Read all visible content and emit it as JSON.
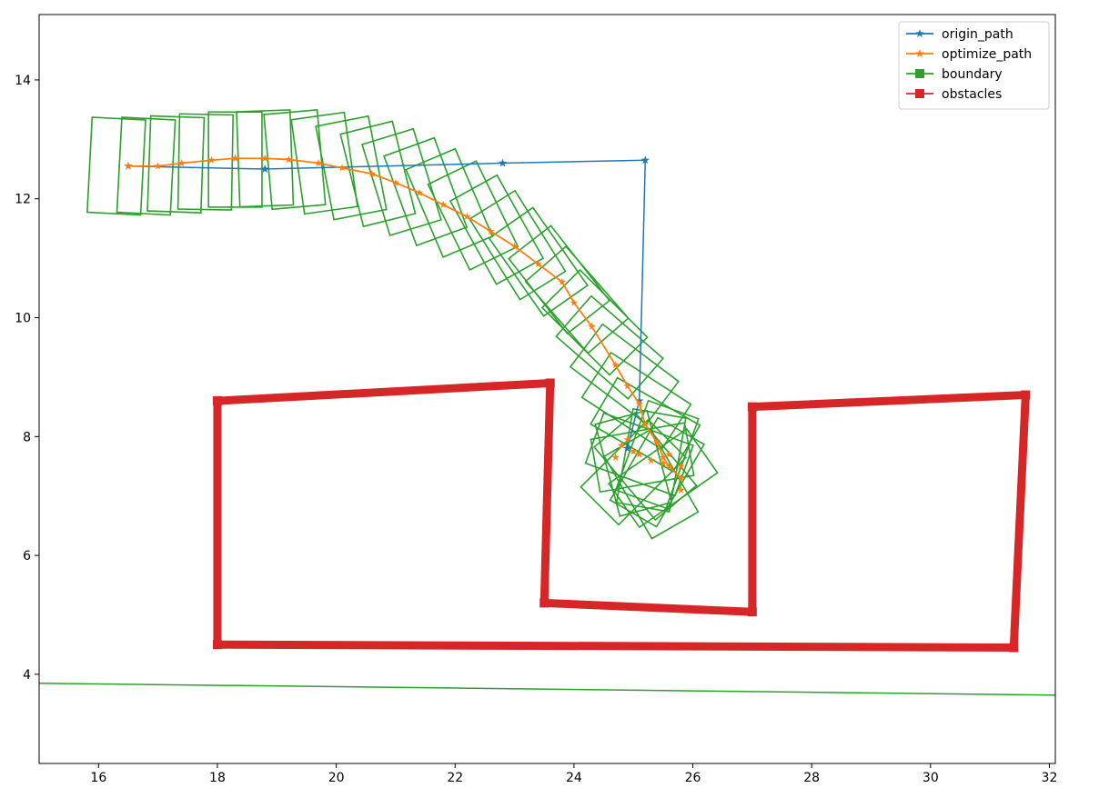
{
  "chart_data": {
    "type": "line",
    "xlim": [
      15,
      32.1
    ],
    "ylim": [
      2.5,
      15.1
    ],
    "x_ticks": [
      16,
      18,
      20,
      22,
      24,
      26,
      28,
      30,
      32
    ],
    "y_ticks": [
      4,
      6,
      8,
      10,
      12,
      14
    ],
    "grid": false,
    "legend_position": "top-right",
    "legend": [
      {
        "label": "origin_path",
        "color": "#1f77b4",
        "marker": "star"
      },
      {
        "label": "optimize_path",
        "color": "#ff7f0e",
        "marker": "star"
      },
      {
        "label": "boundary",
        "color": "#2ca02c",
        "marker": "square"
      },
      {
        "label": "obstacles",
        "color": "#d62728",
        "marker": "square"
      }
    ],
    "origin_path": {
      "name": "origin_path",
      "color": "#1f77b4",
      "x": [
        16.5,
        18.8,
        22.8,
        25.2,
        25.1,
        24.9
      ],
      "y": [
        12.55,
        12.5,
        12.6,
        12.65,
        8.6,
        7.8
      ]
    },
    "optimize_path": {
      "name": "optimize_path",
      "color": "#ff7f0e",
      "x": [
        16.5,
        17.0,
        17.4,
        17.9,
        18.3,
        18.8,
        19.2,
        19.7,
        20.1,
        20.6,
        21.0,
        21.4,
        21.8,
        22.2,
        22.6,
        23.0,
        23.4,
        23.8,
        24.0,
        24.3,
        24.7,
        24.9,
        25.1,
        25.2,
        25.4,
        25.5,
        25.6,
        25.8
      ],
      "y": [
        12.55,
        12.55,
        12.6,
        12.65,
        12.68,
        12.68,
        12.66,
        12.6,
        12.52,
        12.42,
        12.27,
        12.1,
        11.9,
        11.7,
        11.45,
        11.2,
        10.9,
        10.6,
        10.25,
        9.85,
        9.2,
        8.85,
        8.55,
        8.2,
        7.9,
        7.65,
        7.5,
        7.3
      ],
      "jitter": {
        "x": [
          24.7,
          24.9,
          25.1,
          25.3,
          25.5,
          25.6,
          25.8,
          25.8,
          24.8,
          25.0
        ],
        "y": [
          7.65,
          7.95,
          7.7,
          7.6,
          7.55,
          7.7,
          7.5,
          7.1,
          7.85,
          7.75
        ]
      }
    },
    "boundary": {
      "name": "boundary",
      "color": "#2ca02c",
      "box_width": 0.9,
      "box_height": 1.6,
      "arc_boxes": [
        {
          "x": 16.3,
          "y": 12.55,
          "angle": 3
        },
        {
          "x": 16.8,
          "y": 12.55,
          "angle": 3
        },
        {
          "x": 17.3,
          "y": 12.58,
          "angle": 2
        },
        {
          "x": 17.8,
          "y": 12.62,
          "angle": 1
        },
        {
          "x": 18.3,
          "y": 12.66,
          "angle": 0
        },
        {
          "x": 18.8,
          "y": 12.68,
          "angle": -2
        },
        {
          "x": 19.3,
          "y": 12.66,
          "angle": -5
        },
        {
          "x": 19.8,
          "y": 12.6,
          "angle": -8
        },
        {
          "x": 20.25,
          "y": 12.52,
          "angle": -11
        },
        {
          "x": 20.7,
          "y": 12.42,
          "angle": -14
        },
        {
          "x": 21.1,
          "y": 12.28,
          "angle": -17
        },
        {
          "x": 21.5,
          "y": 12.12,
          "angle": -20
        },
        {
          "x": 21.9,
          "y": 11.93,
          "angle": -23
        },
        {
          "x": 22.3,
          "y": 11.72,
          "angle": -26
        },
        {
          "x": 22.7,
          "y": 11.48,
          "angle": -29
        },
        {
          "x": 23.05,
          "y": 11.22,
          "angle": -32
        },
        {
          "x": 23.4,
          "y": 10.94,
          "angle": -35
        },
        {
          "x": 23.75,
          "y": 10.64,
          "angle": -38
        },
        {
          "x": 24.05,
          "y": 10.3,
          "angle": -41
        },
        {
          "x": 24.35,
          "y": 9.92,
          "angle": -45
        },
        {
          "x": 24.6,
          "y": 9.5,
          "angle": -49
        },
        {
          "x": 24.85,
          "y": 9.05,
          "angle": -53
        },
        {
          "x": 25.05,
          "y": 8.6,
          "angle": -57
        },
        {
          "x": 25.2,
          "y": 8.2,
          "angle": -60
        }
      ],
      "cluster_boxes": [
        {
          "x": 25.1,
          "y": 7.7,
          "angle": -70
        },
        {
          "x": 25.3,
          "y": 7.6,
          "angle": 10
        },
        {
          "x": 25.2,
          "y": 7.5,
          "angle": -40
        },
        {
          "x": 25.4,
          "y": 7.4,
          "angle": 30
        },
        {
          "x": 25.0,
          "y": 7.55,
          "angle": -15
        },
        {
          "x": 25.5,
          "y": 7.3,
          "angle": 55
        },
        {
          "x": 25.15,
          "y": 7.65,
          "angle": 80
        },
        {
          "x": 25.3,
          "y": 7.2,
          "angle": -30
        },
        {
          "x": 25.4,
          "y": 7.7,
          "angle": 20
        },
        {
          "x": 25.0,
          "y": 7.4,
          "angle": 45
        }
      ],
      "line": {
        "x": [
          15.0,
          32.1
        ],
        "y": [
          3.85,
          3.65
        ]
      }
    },
    "obstacles": {
      "name": "obstacles",
      "color": "#d62728",
      "x": [
        18.0,
        23.6,
        23.5,
        27.0,
        27.0,
        31.6,
        31.4,
        18.0,
        18.0
      ],
      "y": [
        8.6,
        8.9,
        5.2,
        5.05,
        8.5,
        8.7,
        4.45,
        4.5,
        8.6
      ]
    }
  }
}
